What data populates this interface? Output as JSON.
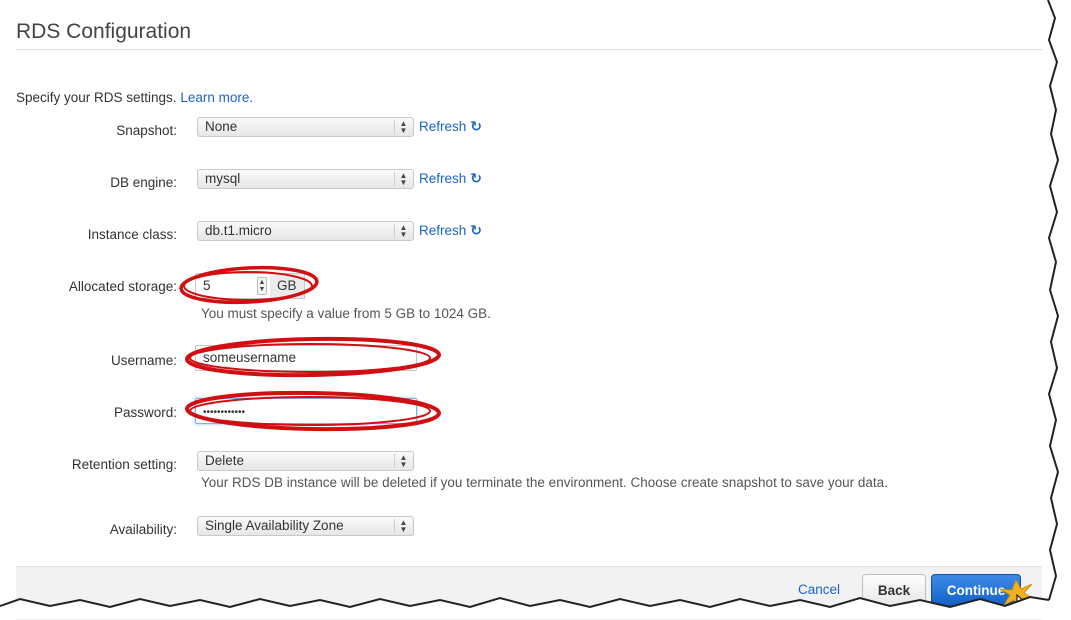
{
  "header": {
    "title": "RDS Configuration"
  },
  "intro": {
    "text": "Specify your RDS settings. ",
    "link": "Learn more."
  },
  "fields": {
    "snapshot": {
      "label": "Snapshot:",
      "value": "None"
    },
    "db_engine": {
      "label": "DB engine:",
      "value": "mysql"
    },
    "instance_class": {
      "label": "Instance class:",
      "value": "db.t1.micro"
    },
    "allocated_storage": {
      "label": "Allocated storage:",
      "value": "5",
      "unit": "GB",
      "help": "You must specify a value from 5 GB to 1024 GB."
    },
    "username": {
      "label": "Username:",
      "value": "someusername"
    },
    "password": {
      "label": "Password:",
      "value": "••••••••••••"
    },
    "retention": {
      "label": "Retention setting:",
      "value": "Delete",
      "help": "Your RDS DB instance will be deleted if you terminate the environment. Choose create snapshot to save your data."
    },
    "availability": {
      "label": "Availability:",
      "value": "Single Availability Zone"
    }
  },
  "refresh": {
    "label": "Refresh",
    "icon": "refresh-icon"
  },
  "footer": {
    "cancel": "Cancel",
    "back": "Back",
    "continue": "Continue"
  },
  "colors": {
    "link": "#1a64c8",
    "primary": "#1260c8",
    "annotation": "#d10f12",
    "cursor_burst": "#f0b020"
  }
}
